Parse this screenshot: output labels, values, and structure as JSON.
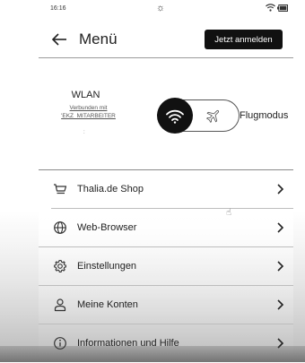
{
  "status_bar": {
    "time": "16:16",
    "center_icon": "brightness-icon",
    "right_icons": [
      "wifi-icon",
      "battery-icon"
    ]
  },
  "header": {
    "back_icon": "arrow-left-icon",
    "title": "Menü",
    "login_label": "Jetzt anmelden"
  },
  "wlan": {
    "title": "WLAN",
    "status_line1": "Verbunden mit",
    "status_line2": "'EKZ_MITARBEITER",
    "status_extra": ":",
    "toggle_state": "wifi",
    "flight_mode_label": "Flugmodus"
  },
  "menu": {
    "items": [
      {
        "label": "Thalia.de Shop",
        "icon": "cart-icon"
      },
      {
        "label": "Web-Browser",
        "icon": "globe-icon"
      },
      {
        "label": "Einstellungen",
        "icon": "gear-icon"
      },
      {
        "label": "Meine Konten",
        "icon": "user-icon"
      },
      {
        "label": "Informationen und Hilfe",
        "icon": "info-icon"
      }
    ]
  },
  "colors": {
    "accent": "#111111",
    "text": "#222222",
    "divider": "#bdbdbd"
  }
}
